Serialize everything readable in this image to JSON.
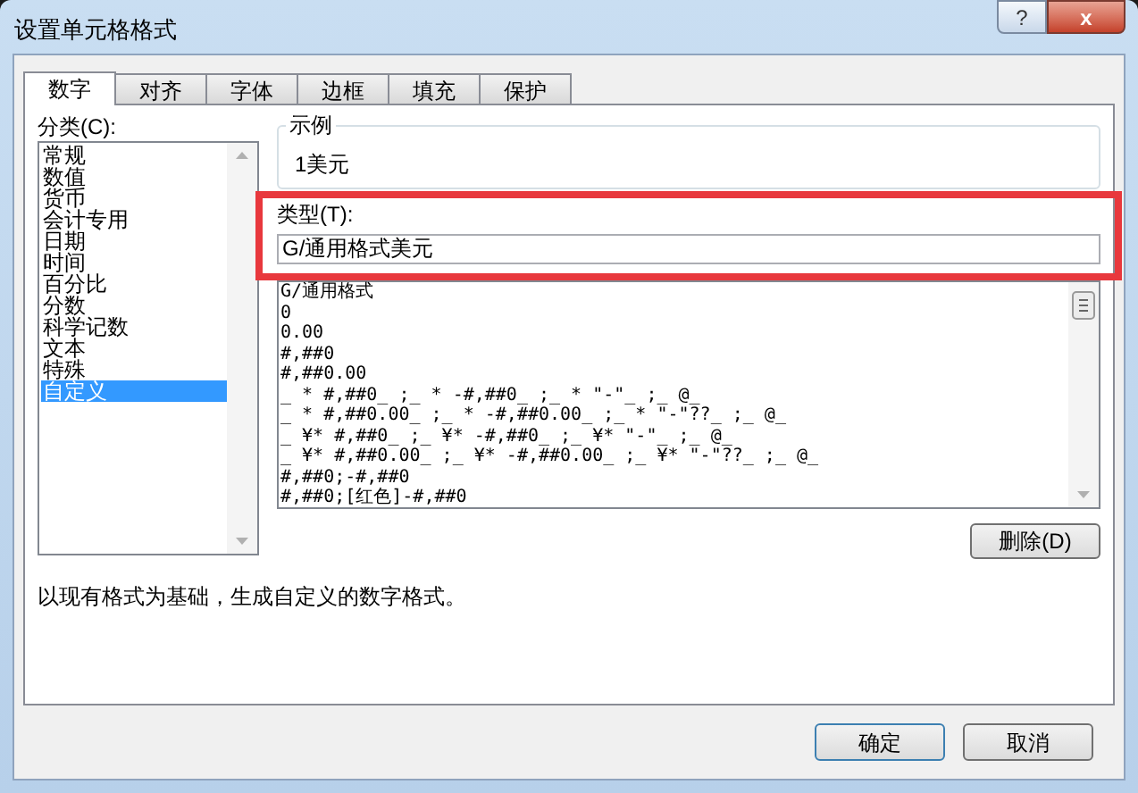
{
  "window": {
    "title": "设置单元格格式",
    "help_button": "?",
    "close_button": "x"
  },
  "tabs": [
    {
      "label": "数字",
      "selected": true
    },
    {
      "label": "对齐",
      "selected": false
    },
    {
      "label": "字体",
      "selected": false
    },
    {
      "label": "边框",
      "selected": false
    },
    {
      "label": "填充",
      "selected": false
    },
    {
      "label": "保护",
      "selected": false
    }
  ],
  "category": {
    "label": "分类(C):",
    "items": [
      {
        "label": "常规",
        "selected": false
      },
      {
        "label": "数值",
        "selected": false
      },
      {
        "label": "货币",
        "selected": false
      },
      {
        "label": "会计专用",
        "selected": false
      },
      {
        "label": "日期",
        "selected": false
      },
      {
        "label": "时间",
        "selected": false
      },
      {
        "label": "百分比",
        "selected": false
      },
      {
        "label": "分数",
        "selected": false
      },
      {
        "label": "科学记数",
        "selected": false
      },
      {
        "label": "文本",
        "selected": false
      },
      {
        "label": "特殊",
        "selected": false
      },
      {
        "label": "自定义",
        "selected": true
      }
    ]
  },
  "sample": {
    "label": "示例",
    "value": "1美元"
  },
  "type": {
    "label": "类型(T):",
    "value": "G/通用格式美元",
    "highlighted": true
  },
  "formats": [
    "G/通用格式",
    "0",
    "0.00",
    "#,##0",
    "#,##0.00",
    "_ * #,##0_ ;_ * -#,##0_ ;_ * \"-\"_ ;_ @_",
    "_ * #,##0.00_ ;_ * -#,##0.00_ ;_ * \"-\"??_ ;_ @_",
    "_ ¥* #,##0_ ;_ ¥* -#,##0_ ;_ ¥* \"-\"_ ;_ @_",
    "_ ¥* #,##0.00_ ;_ ¥* -#,##0.00_ ;_ ¥* \"-\"??_ ;_ @_",
    "#,##0;-#,##0",
    "#,##0;[红色]-#,##0"
  ],
  "delete_button": "删除(D)",
  "description": "以现有格式为基础，生成自定义的数字格式。",
  "buttons": [
    "确定",
    "取消"
  ]
}
